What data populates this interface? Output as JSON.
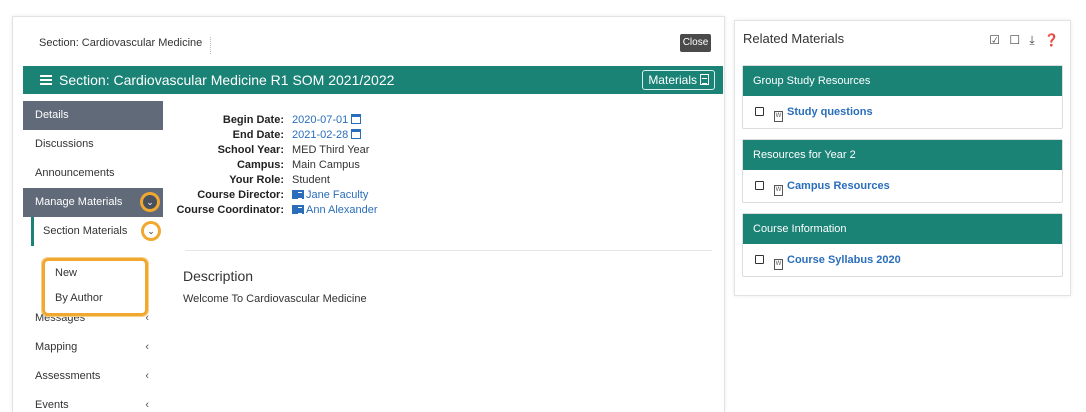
{
  "left": {
    "breadcrumb": "Section: Cardiovascular Medicine",
    "close_label": "Close",
    "section_title": "Section: Cardiovascular Medicine R1 SOM 2021/2022",
    "materials_label": "Materials"
  },
  "sidebar": {
    "items": [
      {
        "label": "Details"
      },
      {
        "label": "Discussions"
      },
      {
        "label": "Announcements"
      },
      {
        "label": "Manage Materials"
      },
      {
        "label": "Section Materials"
      },
      {
        "label": "New"
      },
      {
        "label": "By Author"
      },
      {
        "label": "Messages"
      },
      {
        "label": "Mapping"
      },
      {
        "label": "Assessments"
      },
      {
        "label": "Events"
      }
    ],
    "arrow": "‹",
    "chevron": "⌄"
  },
  "details": {
    "rows": [
      {
        "label": "Begin Date:",
        "value": "2020-07-01"
      },
      {
        "label": "End Date:",
        "value": "2021-02-28"
      },
      {
        "label": "School Year:",
        "value": "MED Third Year"
      },
      {
        "label": "Campus:",
        "value": "Main Campus"
      },
      {
        "label": "Your Role:",
        "value": "Student"
      },
      {
        "label": "Course Director:",
        "value": "Jane Faculty"
      },
      {
        "label": "Course Coordinator:",
        "value": "Ann Alexander"
      }
    ],
    "description_title": "Description",
    "description_text": "Welcome To Cardiovascular Medicine"
  },
  "related": {
    "title": "Related Materials",
    "tools": "☑ ☐ ⤓ ❓",
    "groups": [
      {
        "heading": "Group Study Resources",
        "item": "Study questions"
      },
      {
        "heading": "Resources for Year 2",
        "item": "Campus Resources"
      },
      {
        "heading": "Course Information",
        "item": "Course Syllabus 2020"
      }
    ]
  },
  "colors": {
    "accent": "#1a8376",
    "sidebar_active": "#606a78",
    "highlight": "#f0a830",
    "link": "#2a6ebb"
  }
}
